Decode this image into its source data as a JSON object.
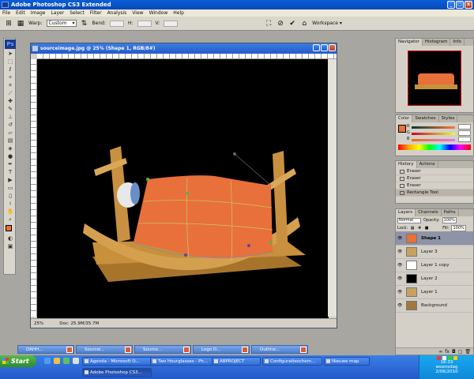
{
  "app": {
    "title": "Adobe Photoshop CS3 Extended"
  },
  "menu": [
    "File",
    "Edit",
    "Image",
    "Layer",
    "Select",
    "Filter",
    "Analysis",
    "View",
    "Window",
    "Help"
  ],
  "options": {
    "warp_label": "Warp:",
    "warp_value": "Custom",
    "bend_label": "Bend:",
    "h_label": "H:",
    "v_label": "V:",
    "workspace": "Workspace ▾"
  },
  "document": {
    "title": "sourceimage.jpg @ 25% (Shape 1, RGB/8#)",
    "zoom": "25%",
    "doc_info": "Doc: 25.9M/35.7M"
  },
  "panels": {
    "navigator_tabs": [
      "Navigator",
      "Histogram",
      "Info"
    ],
    "color_tabs": [
      "Color",
      "Swatches",
      "Styles"
    ],
    "color_labels": [
      "R",
      "G",
      "B"
    ],
    "history_tabs": [
      "History",
      "Actions"
    ],
    "history_items": [
      "Eraser",
      "Eraser",
      "Eraser",
      "Rectangle Tool"
    ],
    "layers_tabs": [
      "Layers",
      "Channels",
      "Paths"
    ],
    "layers_mode": "Normal",
    "opacity_label": "Opacity:",
    "opacity_value": "100%",
    "lock_label": "Lock:",
    "fill_label": "Fill:",
    "fill_value": "100%",
    "layers": [
      {
        "name": "Shape 1",
        "selected": true,
        "thumb": "#e8703a"
      },
      {
        "name": "Layer 3",
        "selected": false,
        "thumb": "#c8a060"
      },
      {
        "name": "Layer 1 copy",
        "selected": false,
        "thumb": "#ffffff"
      },
      {
        "name": "Layer 2",
        "selected": false,
        "thumb": "#000000"
      },
      {
        "name": "Layer 1",
        "selected": false,
        "thumb": "#c8a060"
      },
      {
        "name": "Background",
        "selected": false,
        "thumb": "#a07840"
      }
    ]
  },
  "minimized_windows": [
    "DAHH...",
    "Sourcei...",
    "Source...",
    "Logo D...",
    "Outline..."
  ],
  "taskbar": {
    "start": "Start",
    "buttons": [
      "Agenda - Microsoft O...",
      "Two Hourglasses - Ph...",
      "ABPROJECT",
      "Configuratieschem...",
      "Nieuwe map"
    ],
    "active_button": "Adobe Photoshop CS3...",
    "clock": "16:33",
    "day": "woensdag",
    "date": "2/06/2010"
  },
  "colors": {
    "accent": "#e8703a",
    "xp_blue": "#245ac8",
    "wood": "#c8903a"
  }
}
